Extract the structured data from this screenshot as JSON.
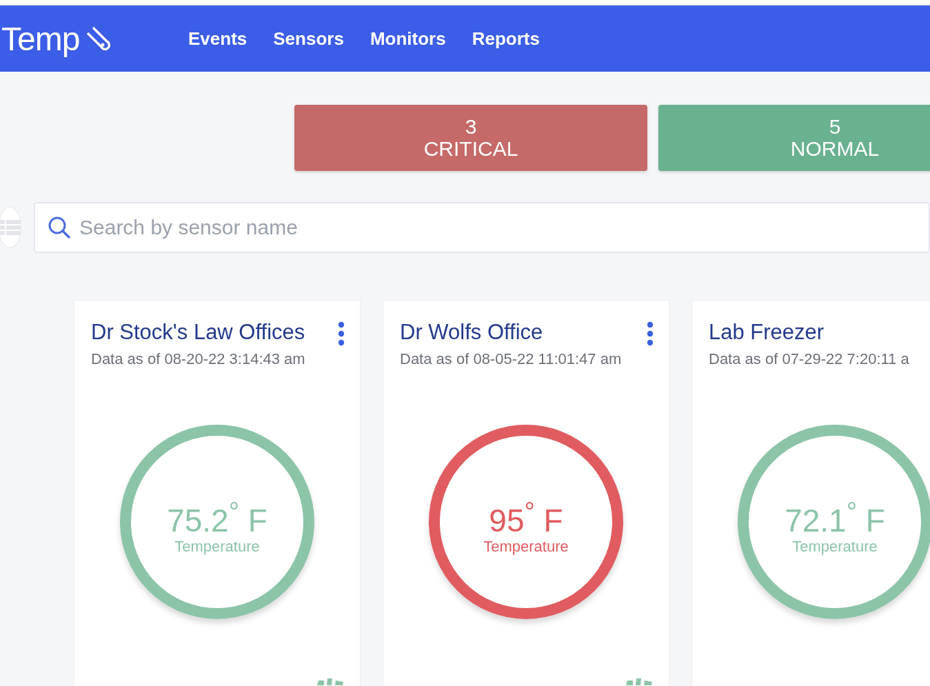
{
  "header": {
    "logo": "Temp",
    "nav": [
      {
        "label": "Events"
      },
      {
        "label": "Sensors"
      },
      {
        "label": "Monitors"
      },
      {
        "label": "Reports"
      }
    ]
  },
  "summary": [
    {
      "kind": "critical",
      "count": "3",
      "label": "CRITICAL"
    },
    {
      "kind": "normal",
      "count": "5",
      "label": "NORMAL"
    }
  ],
  "search": {
    "placeholder": "Search by sensor name"
  },
  "sensors": [
    {
      "name": "Dr Stock's Law Offices",
      "updated": "Data as of 08-20-22 3:14:43 am",
      "menu": true,
      "color": "#8cc4a8",
      "reading": "75.2$^{°}$ F",
      "metric": "Temperature",
      "footer_icon": true
    },
    {
      "name": "Dr Wolfs Office",
      "updated": "Data as of 08-05-22 11:01:47 am",
      "menu": true,
      "color": "#e05c60",
      "reading": "95$^{°}$ F",
      "metric": "Temperature",
      "footer_icon": true
    },
    {
      "name": "Lab Freezer",
      "updated": "Data as of 07-29-22 7:20:11 a",
      "menu": false,
      "color": "#8cc4a8",
      "reading": "72.1$^{°}$ F",
      "metric": "Temperature",
      "footer_icon": false
    }
  ]
}
